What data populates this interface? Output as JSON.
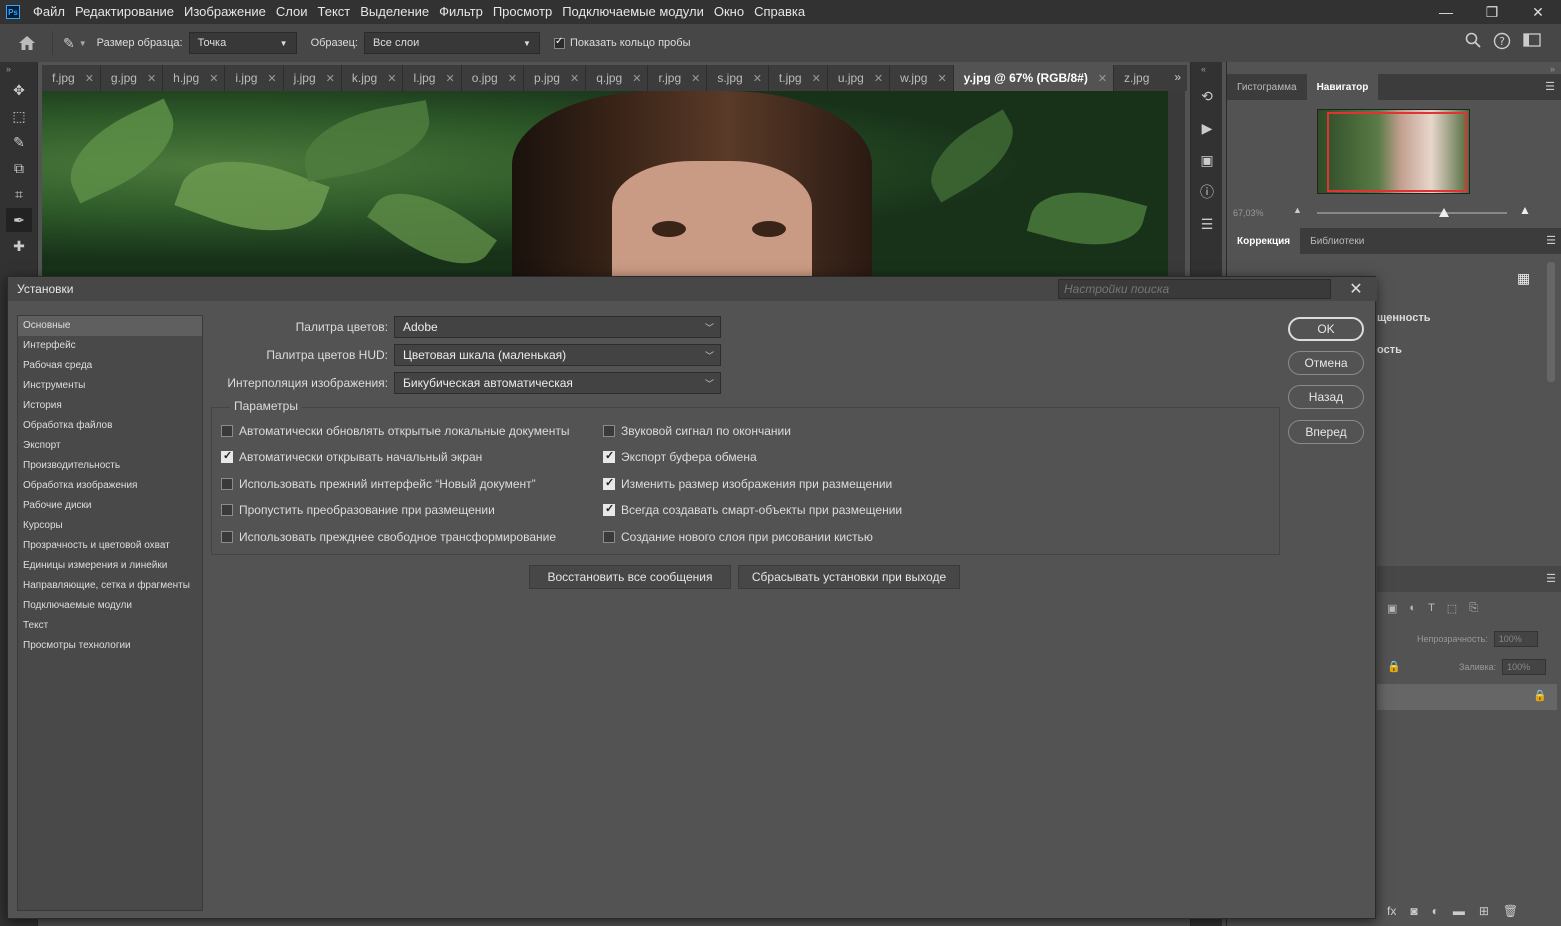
{
  "app": {
    "logo": "Ps",
    "menu": [
      "Файл",
      "Редактирование",
      "Изображение",
      "Слои",
      "Текст",
      "Выделение",
      "Фильтр",
      "Просмотр",
      "Подключаемые модули",
      "Окно",
      "Справка"
    ]
  },
  "options": {
    "sample_size_label": "Размер образца:",
    "sample_size_value": "Точка",
    "sample_label": "Образец:",
    "sample_value": "Все слои",
    "show_ring_label": "Показать кольцо пробы"
  },
  "tabs": [
    {
      "label": "f.jpg"
    },
    {
      "label": "g.jpg"
    },
    {
      "label": "h.jpg"
    },
    {
      "label": "i.jpg"
    },
    {
      "label": "j.jpg"
    },
    {
      "label": "k.jpg"
    },
    {
      "label": "l.jpg"
    },
    {
      "label": "o.jpg"
    },
    {
      "label": "p.jpg"
    },
    {
      "label": "q.jpg"
    },
    {
      "label": "r.jpg"
    },
    {
      "label": "s.jpg"
    },
    {
      "label": "t.jpg"
    },
    {
      "label": "u.jpg"
    },
    {
      "label": "w.jpg"
    },
    {
      "label": "y.jpg @ 67% (RGB/8#)",
      "active": true
    },
    {
      "label": "z.jpg"
    }
  ],
  "panels": {
    "top_tabs": [
      "Гистограмма",
      "Навигатор"
    ],
    "zoom": "67,03%",
    "zoom_level": 0.67,
    "adj_tabs": [
      "Коррекция",
      "Библиотеки"
    ],
    "partial1": "щенность",
    "partial2": "ость",
    "opacity_label": "Непрозрачность:",
    "opacity_value": "100%",
    "fill_label": "Заливка:",
    "fill_value": "100%"
  },
  "dialog": {
    "title": "Установки",
    "search_placeholder": "Настройки поиска",
    "categories": [
      "Основные",
      "Интерфейс",
      "Рабочая среда",
      "Инструменты",
      "История",
      "Обработка файлов",
      "Экспорт",
      "Производительность",
      "Обработка изображения",
      "Рабочие диски",
      "Курсоры",
      "Прозрачность и цветовой охват",
      "Единицы измерения и линейки",
      "Направляющие, сетка и фрагменты",
      "Подключаемые модули",
      "Текст",
      "Просмотры технологии"
    ],
    "fields": [
      {
        "label": "Палитра цветов:",
        "value": "Adobe"
      },
      {
        "label": "Палитра цветов HUD:",
        "value": "Цветовая шкала (маленькая)"
      },
      {
        "label": "Интерполяция изображения:",
        "value": "Бикубическая автоматическая"
      }
    ],
    "params_title": "Параметры",
    "checks_left": [
      {
        "label": "Автоматически обновлять открытые локальные документы",
        "checked": false
      },
      {
        "label": "Автоматически открывать начальный экран",
        "checked": true
      },
      {
        "label": "Использовать прежний интерфейс “Новый документ”",
        "checked": false
      },
      {
        "label": "Пропустить преобразование при размещении",
        "checked": false
      },
      {
        "label": "Использовать прежднее свободное трансформирование",
        "checked": false
      }
    ],
    "checks_right": [
      {
        "label": "Звуковой сигнал по окончании",
        "checked": false
      },
      {
        "label": "Экспорт буфера обмена",
        "checked": true
      },
      {
        "label": "Изменить размер изображения при размещении",
        "checked": true
      },
      {
        "label": "Всегда создавать смарт-объекты при размещении",
        "checked": true
      },
      {
        "label": "Создание нового слоя при рисовании кистью",
        "checked": false
      }
    ],
    "buttons": {
      "ok": "OK",
      "cancel": "Отмена",
      "back": "Назад",
      "forward": "Вперед"
    },
    "restore_messages": "Восстановить все сообщения",
    "reset_on_exit": "Сбрасывать установки при выходе"
  }
}
